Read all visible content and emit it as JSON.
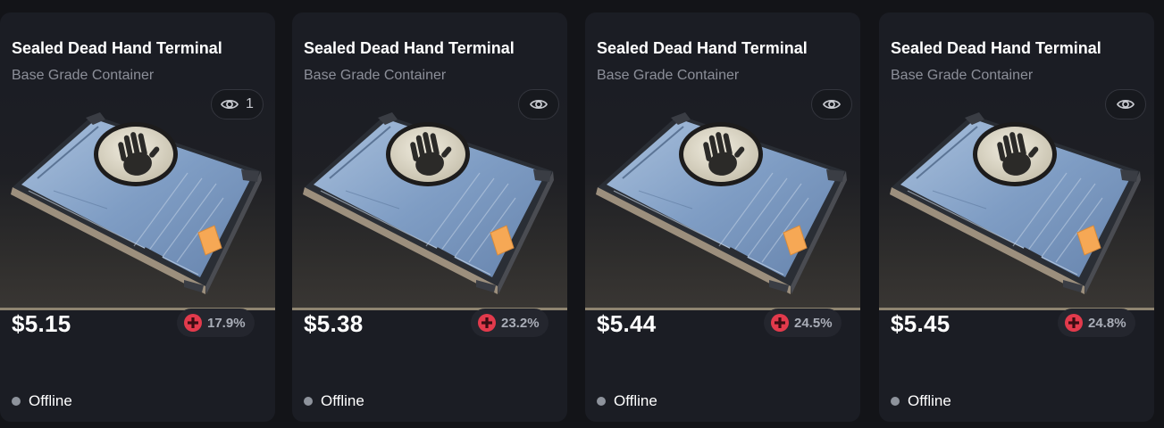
{
  "colors": {
    "background": "#131418",
    "card": "#1b1d24",
    "accent_line": "#8f8570",
    "discount_icon": "#e23a4c",
    "offline_dot": "#8e939c"
  },
  "icons": {
    "view": "eye-icon",
    "discount": "plus-circle-icon",
    "status": "status-dot-icon"
  },
  "cards": [
    {
      "title": "Sealed Dead Hand Terminal",
      "subtitle": "Base Grade Container",
      "views": "1",
      "price": "$5.15",
      "discount": "17.9%",
      "status": "Offline"
    },
    {
      "title": "Sealed Dead Hand Terminal",
      "subtitle": "Base Grade Container",
      "views": "",
      "price": "$5.38",
      "discount": "23.2%",
      "status": "Offline"
    },
    {
      "title": "Sealed Dead Hand Terminal",
      "subtitle": "Base Grade Container",
      "views": "",
      "price": "$5.44",
      "discount": "24.5%",
      "status": "Offline"
    },
    {
      "title": "Sealed Dead Hand Terminal",
      "subtitle": "Base Grade Container",
      "views": "",
      "price": "$5.45",
      "discount": "24.8%",
      "status": "Offline"
    }
  ]
}
